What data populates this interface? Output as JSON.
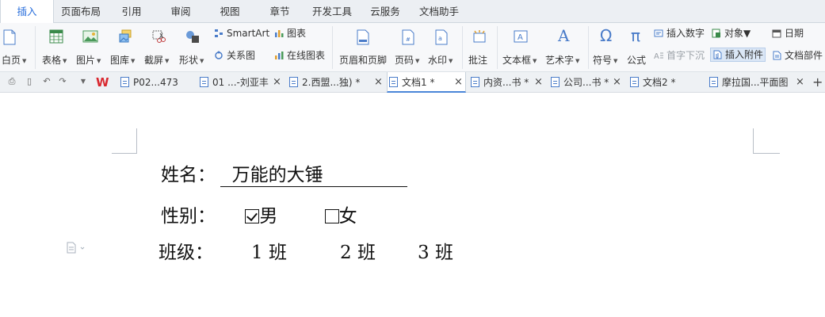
{
  "menu": {
    "tabs": [
      {
        "label": "插入",
        "active": true
      },
      {
        "label": "页面布局"
      },
      {
        "label": "引用"
      },
      {
        "label": "审阅"
      },
      {
        "label": "视图"
      },
      {
        "label": "章节"
      },
      {
        "label": "开发工具"
      },
      {
        "label": "云服务"
      },
      {
        "label": "文档助手"
      }
    ]
  },
  "ribbon": {
    "blank_page": "白页",
    "table": "表格",
    "picture": "图片",
    "gallery": "图库",
    "screenshot": "截屏",
    "shapes": "形状",
    "smartart": "SmartArt",
    "chart": "图表",
    "relation_chart": "关系图",
    "online_chart": "在线图表",
    "header_footer": "页眉和页脚",
    "page_number": "页码",
    "watermark": "水印",
    "comment": "批注",
    "textbox": "文本框",
    "wordart": "艺术字",
    "symbol": "符号",
    "formula": "公式",
    "insert_number": "插入数字",
    "object": "对象",
    "date": "日期",
    "drop_cap": "首字下沉",
    "insert_attachment": "插入附件",
    "doc_parts": "文档部件"
  },
  "doc_tabs": [
    {
      "label": "P02...473",
      "active": false
    },
    {
      "label": "01 ...-刘亚丰",
      "active": false
    },
    {
      "label": "2.西盟...独)  *",
      "active": false
    },
    {
      "label": "文档1 *",
      "active": true
    },
    {
      "label": "内资...书 *",
      "active": false
    },
    {
      "label": "公司...书 *",
      "active": false
    },
    {
      "label": "文档2 *",
      "active": false
    },
    {
      "label": "摩拉国...平面图",
      "active": false
    }
  ],
  "doc_tabs_close": "×",
  "add_tab": "+",
  "document": {
    "name_label": "姓名：",
    "name_value": "  万能的大锤    ",
    "gender_label": "性别：",
    "gender_options": [
      {
        "label": "男",
        "checked": true
      },
      {
        "label": "女",
        "checked": false
      }
    ],
    "class_label": "班级：",
    "class_options": [
      "1 班",
      "2 班",
      "3 班"
    ]
  },
  "colors": {
    "accent": "#2a6fdc",
    "wps_red": "#d9272e"
  }
}
